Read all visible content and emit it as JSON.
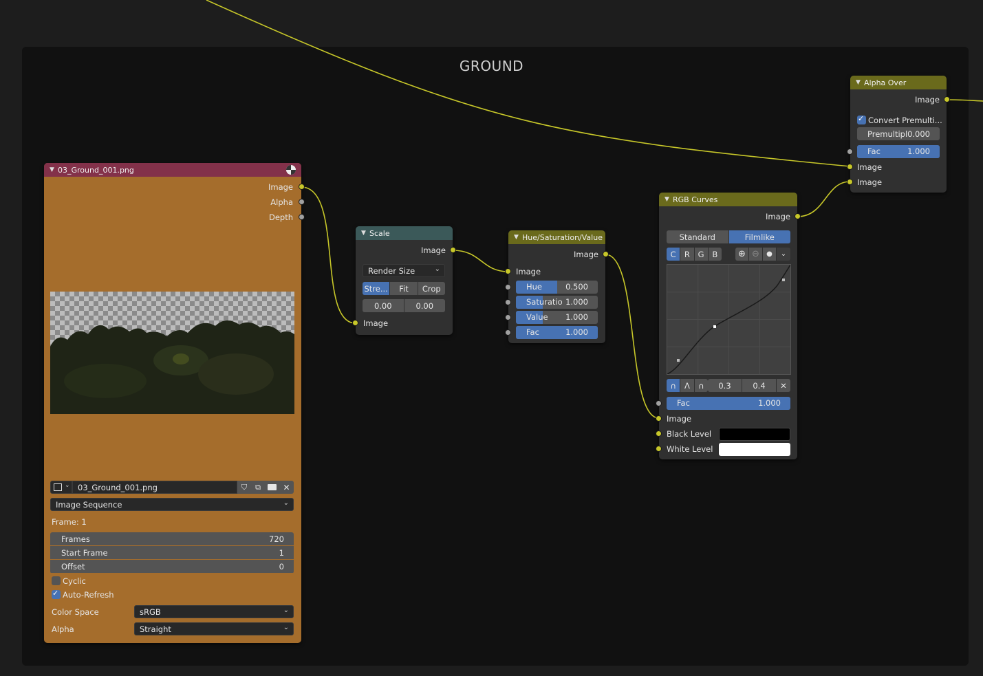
{
  "frame": {
    "label": "GROUND"
  },
  "image_node": {
    "title": "03_Ground_001.png",
    "outputs": [
      "Image",
      "Alpha",
      "Depth"
    ],
    "file_name": "03_Ground_001.png",
    "source": "Image Sequence",
    "frame_text": "Frame: 1",
    "props": [
      {
        "label": "Frames",
        "value": "720"
      },
      {
        "label": "Start Frame",
        "value": "1"
      },
      {
        "label": "Offset",
        "value": "0"
      }
    ],
    "cyclic_label": "Cyclic",
    "cyclic": false,
    "auto_refresh_label": "Auto-Refresh",
    "auto_refresh": true,
    "color_space_label": "Color Space",
    "color_space": "sRGB",
    "alpha_label": "Alpha",
    "alpha": "Straight"
  },
  "scale_node": {
    "title": "Scale",
    "output": "Image",
    "space": "Render Size",
    "modes": [
      "Stre...",
      "Fit",
      "Crop"
    ],
    "offset_x": "0.00",
    "offset_y": "0.00",
    "input": "Image"
  },
  "hsv_node": {
    "title": "Hue/Saturation/Value",
    "output": "Image",
    "input": "Image",
    "sliders": [
      {
        "label": "Hue",
        "value": "0.500",
        "fraction": 0.5
      },
      {
        "label": "Saturatio",
        "value": "1.000",
        "fraction": 0.33
      },
      {
        "label": "Value",
        "value": "1.000",
        "fraction": 0.33
      },
      {
        "label": "Fac",
        "value": "1.000",
        "fraction": 1.0
      }
    ]
  },
  "curves_node": {
    "title": "RGB Curves",
    "output": "Image",
    "tabs": [
      "Standard",
      "Filmlike"
    ],
    "channels": [
      "C",
      "R",
      "G",
      "B"
    ],
    "point_x": "0.3",
    "point_y": "0.4",
    "fac_label": "Fac",
    "fac_value": "1.000",
    "inputs": [
      "Image",
      "Black Level",
      "White Level"
    ],
    "black_color": "#000000",
    "white_color": "#ffffff"
  },
  "alpha_over_node": {
    "title": "Alpha Over",
    "output": "Image",
    "convert_label": "Convert Premulti...",
    "convert": true,
    "premul_label": "Premultipl",
    "premul_value": "0.000",
    "fac_label": "Fac",
    "fac_value": "1.000",
    "inputs": [
      "Image",
      "Image"
    ]
  },
  "colors": {
    "image_header": "#83314a",
    "image_body": "#a56d2c",
    "scale_header": "#3b5959",
    "color_header": "#6a6a1c",
    "link": "#c7c729",
    "accent": "#4772b3"
  }
}
